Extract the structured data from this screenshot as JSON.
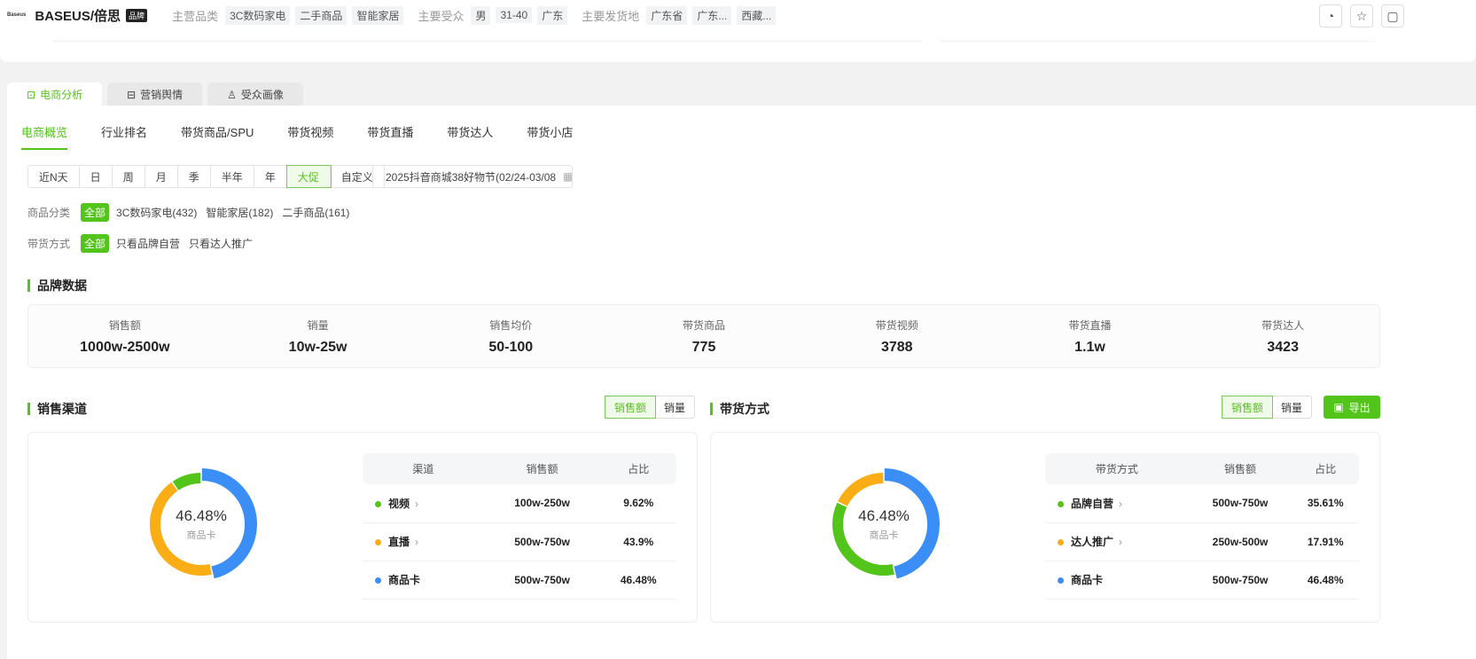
{
  "header": {
    "logo_text": "Baseus倍思",
    "brand_name": "BASEUS/倍思",
    "brand_badge": "品牌",
    "category_label": "主营品类",
    "categories": [
      "3C数码家电",
      "二手商品",
      "智能家居"
    ],
    "audience_label": "主要受众",
    "audience": [
      "男",
      "31-40",
      "广东"
    ],
    "ship_label": "主要发货地",
    "ship": [
      "广东省",
      "广东...",
      "西藏..."
    ]
  },
  "tabs": [
    "电商分析",
    "营销舆情",
    "受众画像"
  ],
  "subnav": [
    "电商概览",
    "行业排名",
    "带货商品/SPU",
    "带货视频",
    "带货直播",
    "带货达人",
    "带货小店"
  ],
  "time_segments": [
    "近N天",
    "日",
    "周",
    "月",
    "季",
    "半年",
    "年",
    "大促",
    "自定义"
  ],
  "date_range": "2025抖音商城38好物节(02/24-03/08",
  "filters": {
    "category_label": "商品分类",
    "category_options": [
      "全部",
      "3C数码家电(432)",
      "智能家居(182)",
      "二手商品(161)"
    ],
    "mode_label": "带货方式",
    "mode_options": [
      "全部",
      "只看品牌自营",
      "只看达人推广"
    ]
  },
  "brand_data": {
    "title": "品牌数据",
    "stats": [
      {
        "label": "销售额",
        "value": "1000w-2500w"
      },
      {
        "label": "销量",
        "value": "10w-25w"
      },
      {
        "label": "销售均价",
        "value": "50-100"
      },
      {
        "label": "带货商品",
        "value": "775"
      },
      {
        "label": "带货视频",
        "value": "3788"
      },
      {
        "label": "带货直播",
        "value": "1.1w"
      },
      {
        "label": "带货达人",
        "value": "3423"
      }
    ]
  },
  "colors": {
    "green": "#52c41a",
    "orange": "#faad14",
    "blue": "#3a8ef6"
  },
  "channel": {
    "title": "销售渠道",
    "toggle": [
      "销售额",
      "销量"
    ],
    "center_pct": "46.48%",
    "center_name": "商品卡",
    "headers": [
      "渠道",
      "销售额",
      "占比"
    ],
    "rows": [
      {
        "name": "视频",
        "sales": "100w-250w",
        "pct": "9.62%",
        "value": 9.62,
        "color": "#52c41a",
        "link": true
      },
      {
        "name": "直播",
        "sales": "500w-750w",
        "pct": "43.9%",
        "value": 43.9,
        "color": "#faad14",
        "link": true
      },
      {
        "name": "商品卡",
        "sales": "500w-750w",
        "pct": "46.48%",
        "value": 46.48,
        "color": "#3a8ef6",
        "link": false
      }
    ]
  },
  "mode": {
    "title": "带货方式",
    "toggle": [
      "销售额",
      "销量"
    ],
    "export": "导出",
    "center_pct": "46.48%",
    "center_name": "商品卡",
    "headers": [
      "带货方式",
      "销售额",
      "占比"
    ],
    "rows": [
      {
        "name": "品牌自营",
        "sales": "500w-750w",
        "pct": "35.61%",
        "value": 35.61,
        "color": "#52c41a",
        "link": true
      },
      {
        "name": "达人推广",
        "sales": "250w-500w",
        "pct": "17.91%",
        "value": 17.91,
        "color": "#faad14",
        "link": true
      },
      {
        "name": "商品卡",
        "sales": "500w-750w",
        "pct": "46.48%",
        "value": 46.48,
        "color": "#3a8ef6",
        "link": false
      }
    ]
  }
}
